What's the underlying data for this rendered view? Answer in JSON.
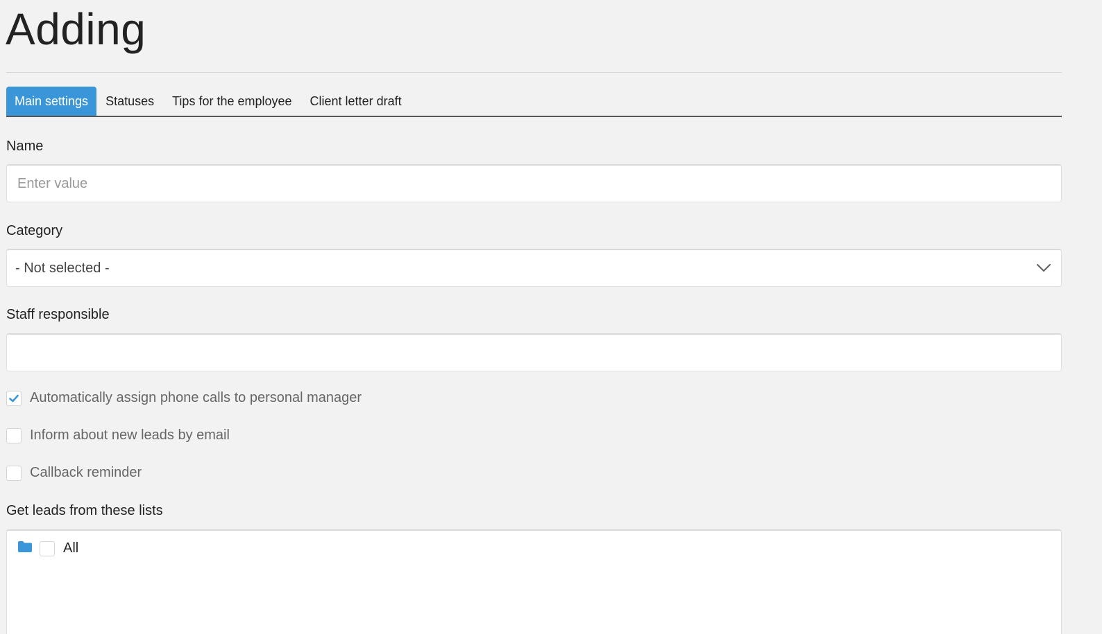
{
  "page": {
    "title": "Adding"
  },
  "tabs": [
    {
      "label": "Main settings",
      "active": true
    },
    {
      "label": "Statuses",
      "active": false
    },
    {
      "label": "Tips for the employee",
      "active": false
    },
    {
      "label": "Client letter draft",
      "active": false
    }
  ],
  "form": {
    "name": {
      "label": "Name",
      "value": "",
      "placeholder": "Enter value"
    },
    "category": {
      "label": "Category",
      "selected": "- Not selected -"
    },
    "staff": {
      "label": "Staff responsible",
      "value": ""
    },
    "checkboxes": [
      {
        "label": "Automatically assign phone calls to personal manager",
        "checked": true
      },
      {
        "label": "Inform about new leads by email",
        "checked": false
      },
      {
        "label": "Callback reminder",
        "checked": false
      }
    ],
    "lists": {
      "label": "Get leads from these lists",
      "items": [
        {
          "label": "All",
          "checked": false
        }
      ]
    }
  },
  "colors": {
    "accent": "#3a96d8",
    "background": "#f2f2f2"
  },
  "icons": {
    "chevron": "chevron-down-icon",
    "check": "checkmark-icon",
    "folder": "folder-icon"
  }
}
